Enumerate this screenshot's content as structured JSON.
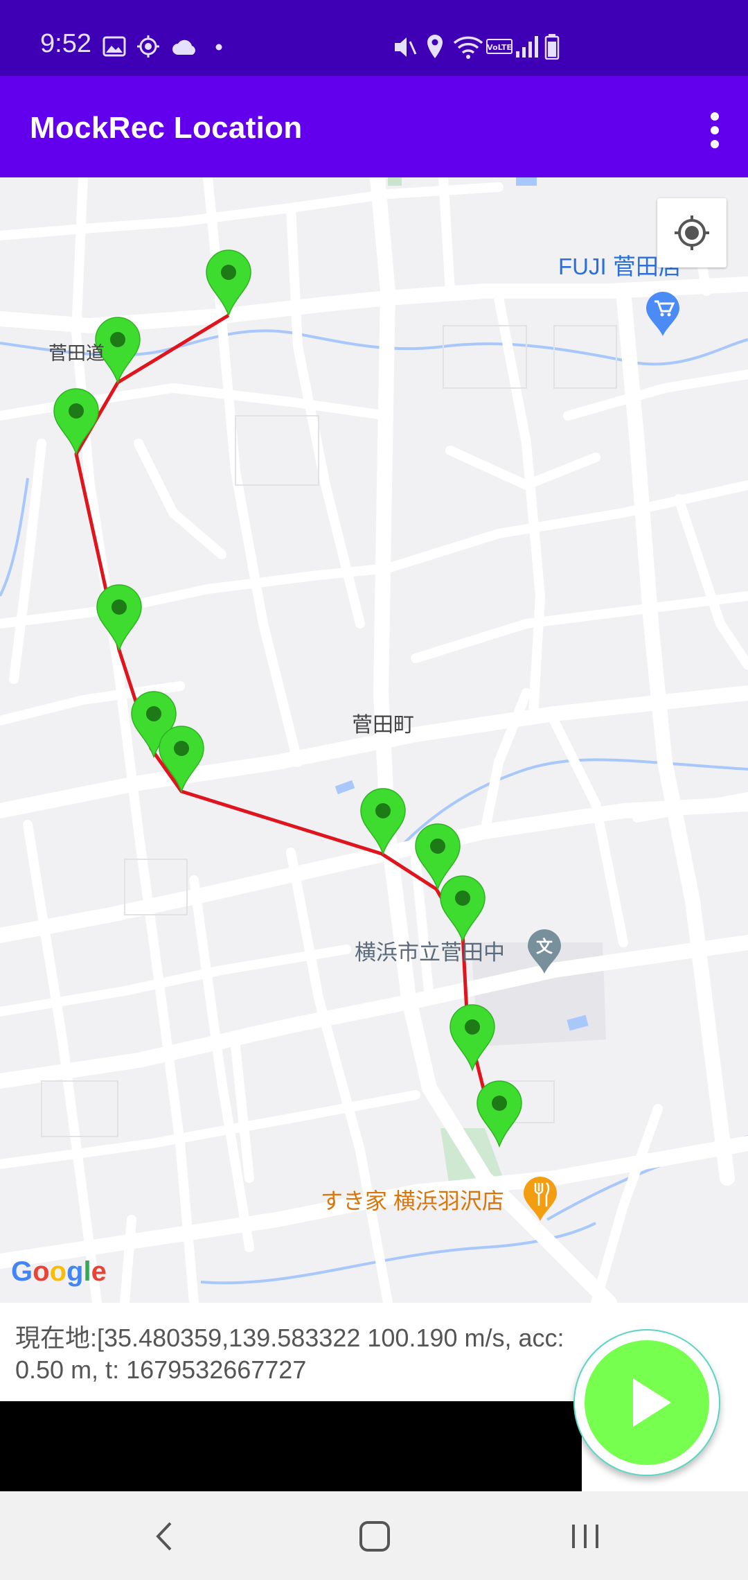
{
  "status_bar": {
    "time": "9:52",
    "left_icons": [
      "gallery-icon",
      "location-target-icon",
      "cloud-icon",
      "dot-icon"
    ],
    "right_icons": [
      "mute-icon",
      "location-pin-icon",
      "wifi-icon",
      "volte-icon",
      "signal-icon",
      "battery-icon"
    ]
  },
  "app_bar": {
    "title": "MockRec Location",
    "menu_icon": "overflow-menu-icon",
    "color": "#6200EE"
  },
  "map": {
    "labels": {
      "fuji": "FUJI 菅田店",
      "sugata_michi": "菅田道",
      "sugata_cho": "菅田町",
      "school": "横浜市立菅田中",
      "sukiya": "すき家 横浜羽沢店"
    },
    "google_logo": "Google",
    "route_color": "#E0141C",
    "marker_color": "#3DDC2F",
    "marker_count": 12
  },
  "info": {
    "location_text": "現在地:[35.480359,139.583322 100.190 m/s, acc: 0.50 m, t: 1679532667727"
  },
  "fab": {
    "icon": "play-icon",
    "color": "#76FF4F"
  },
  "nav_bar": {
    "icons": [
      "back-icon",
      "home-icon",
      "recents-icon"
    ]
  }
}
